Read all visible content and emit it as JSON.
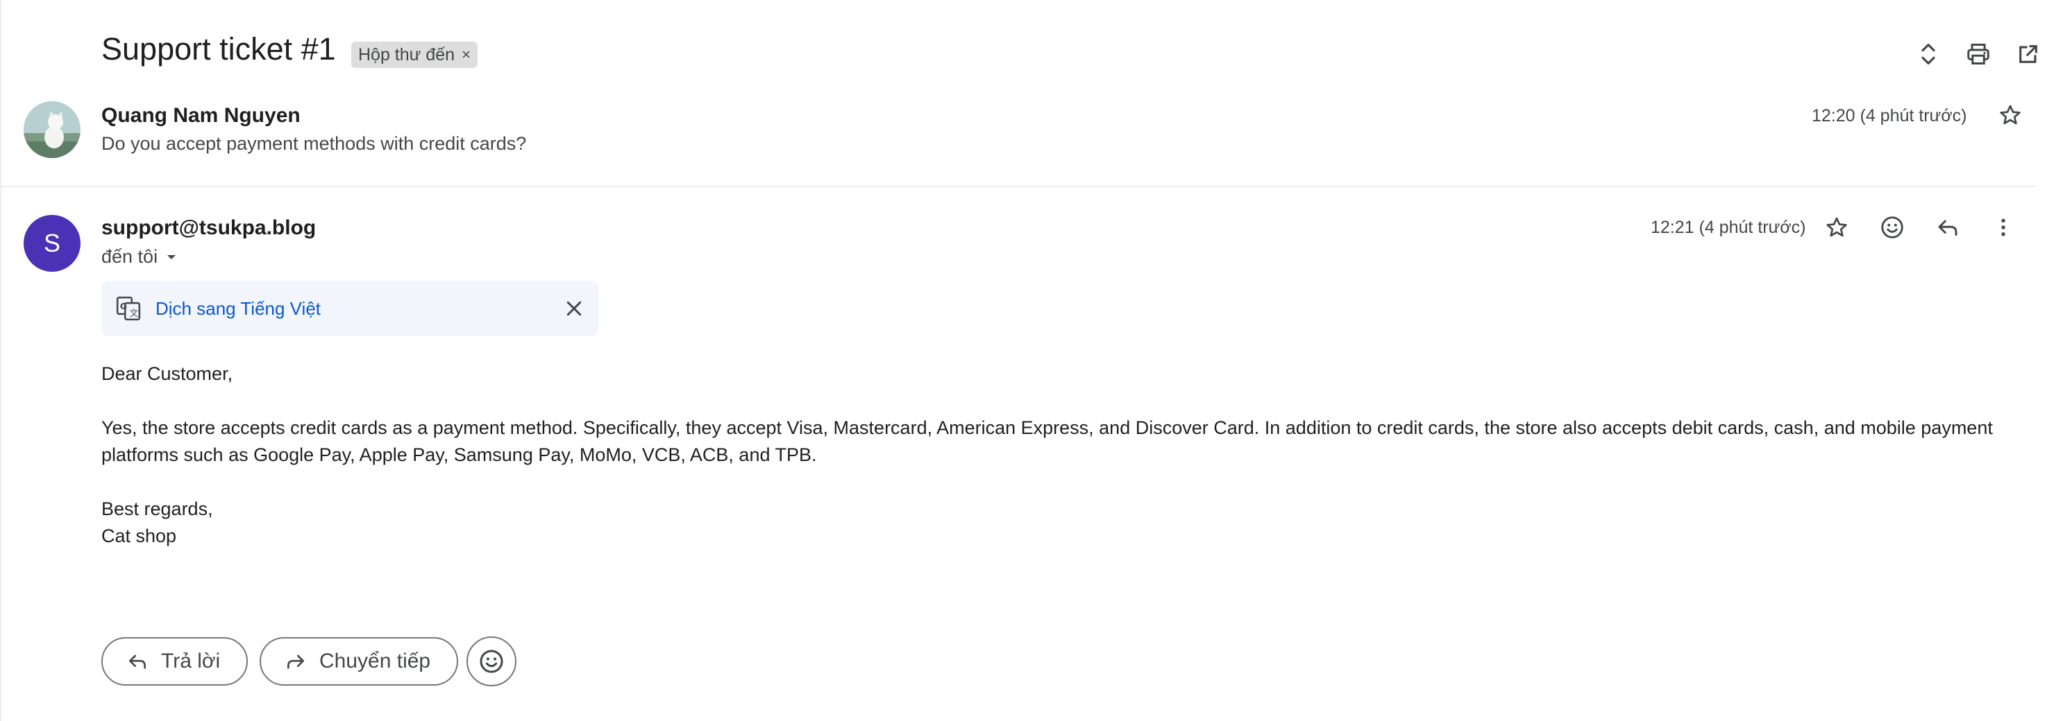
{
  "thread": {
    "subject": "Support ticket #1",
    "label": "Hộp thư đến",
    "label_remove": "×"
  },
  "header_icons": [
    "expand-collapse-icon",
    "print-icon",
    "open-new-window-icon"
  ],
  "messages": [
    {
      "sender": "Quang Nam Nguyen",
      "snippet": "Do you accept payment methods with credit cards?",
      "time": "12:20 (4 phút trước)",
      "avatar": "photo"
    },
    {
      "sender": "support@tsukpa.blog",
      "avatar_letter": "S",
      "avatar_color": "#4a32b6",
      "recipient": "đến tôi",
      "time": "12:21 (4 phút trước)",
      "translate_link": "Dịch sang Tiếng Việt",
      "body": {
        "greeting": "Dear Customer,",
        "paragraph": "Yes, the store accepts credit cards as a payment method. Specifically, they accept Visa, Mastercard, American Express, and Discover Card. In addition to credit cards, the store also accepts debit cards, cash, and mobile payment platforms such as Google Pay, Apple Pay, Samsung Pay, MoMo, VCB, ACB, and TPB.",
        "closing": "Best regards,",
        "signature": "Cat shop"
      }
    }
  ],
  "actions": {
    "reply": "Trả lời",
    "forward": "Chuyển tiếp"
  },
  "colors": {
    "link": "#0b57d0",
    "translate_bg": "#f2f6fc",
    "label_bg": "#dddddd"
  }
}
